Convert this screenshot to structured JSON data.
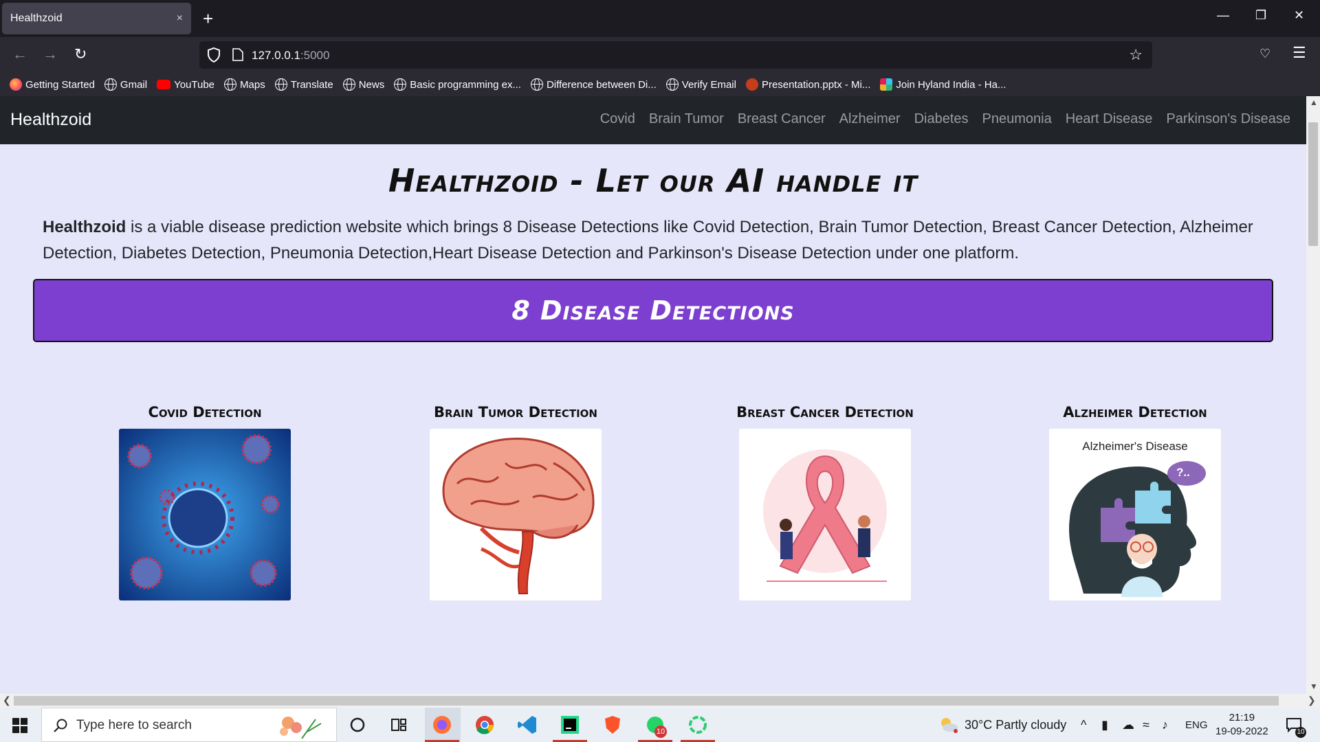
{
  "browser": {
    "tab_title": "Healthzoid",
    "tab_close": "×",
    "new_tab": "+",
    "url_host": "127.0.0.1",
    "url_port": ":5000",
    "bookmarks": [
      {
        "label": "Getting Started",
        "icon": "firefox-icon"
      },
      {
        "label": "Gmail",
        "icon": "globe-icon"
      },
      {
        "label": "YouTube",
        "icon": "youtube-icon"
      },
      {
        "label": "Maps",
        "icon": "globe-icon"
      },
      {
        "label": "Translate",
        "icon": "globe-icon"
      },
      {
        "label": "News",
        "icon": "globe-icon"
      },
      {
        "label": "Basic programming ex...",
        "icon": "globe-icon"
      },
      {
        "label": "Difference between Di...",
        "icon": "globe-icon"
      },
      {
        "label": "Verify Email",
        "icon": "globe-icon"
      },
      {
        "label": "Presentation.pptx - Mi...",
        "icon": "powerpoint-icon"
      },
      {
        "label": "Join Hyland India - Ha...",
        "icon": "slack-icon"
      }
    ]
  },
  "site": {
    "brand": "Healthzoid",
    "nav": [
      "Covid",
      "Brain Tumor",
      "Breast Cancer",
      "Alzheimer",
      "Diabetes",
      "Pneumonia",
      "Heart Disease",
      "Parkinson's Disease"
    ],
    "title": "Healthzoid - Let our AI handle it",
    "intro_bold": "Healthzoid",
    "intro_rest": " is a viable disease prediction website which brings 8 Disease Detections like Covid Detection, Brain Tumor Detection, Breast Cancer Detection, Alzheimer Detection, Diabetes Detection, Pneumonia Detection,Heart Disease Detection and Parkinson's Disease Detection under one platform.",
    "banner": "8 Disease Detections",
    "cards": [
      {
        "title": "Covid Detection"
      },
      {
        "title": "Brain Tumor Detection"
      },
      {
        "title": "Breast Cancer Detection"
      },
      {
        "title": "Alzheimer Detection",
        "image_caption": "Alzheimer's Disease",
        "bubble": "?.."
      }
    ]
  },
  "taskbar": {
    "search_placeholder": "Type here to search",
    "weather": "30°C  Partly cloudy",
    "lang": "ENG",
    "time": "21:19",
    "date": "19-09-2022",
    "whatsapp_badge": "10",
    "notif_badge": "10",
    "accent": "#c0392b"
  },
  "colors": {
    "page_bg": "#e6e6fa",
    "navbar_bg": "#212529",
    "banner_bg": "#7c3fcf"
  }
}
